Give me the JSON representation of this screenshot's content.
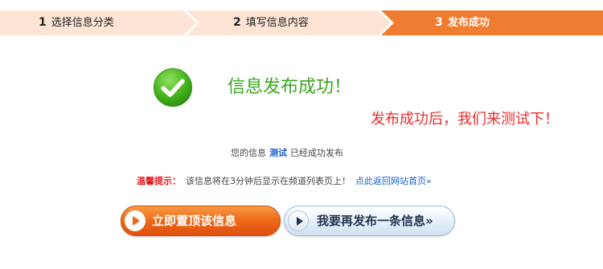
{
  "steps": [
    {
      "number": "1",
      "label": "选择信息分类"
    },
    {
      "number": "2",
      "label": "填写信息内容"
    },
    {
      "number": "3",
      "label": "发布成功"
    }
  ],
  "active_step": 3,
  "colors": {
    "step_inactive": "#fde4d4",
    "step_active": "#f07c2f",
    "success_green": "#3aa61e",
    "annotation_red": "#ec2c2c",
    "link_blue": "#1a5fc7"
  },
  "success": {
    "icon": "check-circle-icon",
    "title": "信息发布成功！"
  },
  "annotation": "发布成功后，我们来测试下！",
  "published": {
    "prefix": "您的信息",
    "item_name": "测试",
    "suffix": "已经成功发布"
  },
  "tip": {
    "label": "温馨提示：",
    "text": "该信息将在3分钟后显示在频道列表页上！",
    "link": "点此返回网站首页»"
  },
  "buttons": {
    "top": {
      "label": "立即置顶该信息",
      "icon": "play-icon"
    },
    "again": {
      "label": "我要再发布一条信息»",
      "icon": "play-icon"
    }
  }
}
